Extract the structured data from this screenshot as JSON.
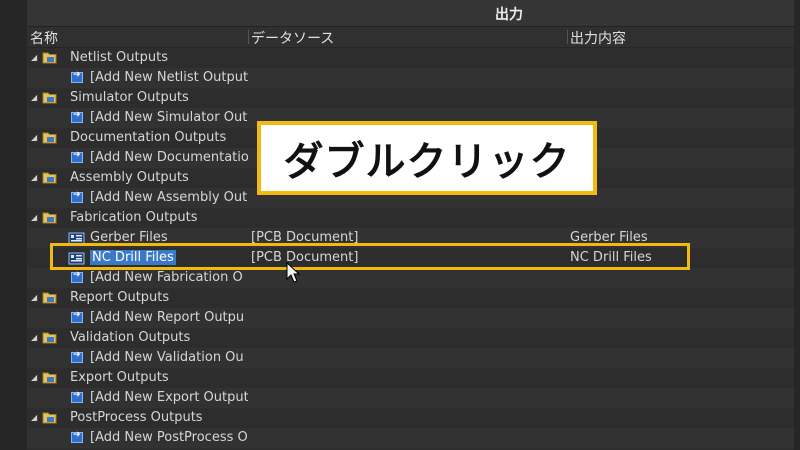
{
  "panel": {
    "title": "出力",
    "columns": [
      "名称",
      "データソース",
      "出力内容"
    ]
  },
  "rows": [
    {
      "kind": "group",
      "name": "Netlist Outputs"
    },
    {
      "kind": "child",
      "name": "[Add New Netlist Output",
      "icon": "add-icon"
    },
    {
      "kind": "group",
      "name": "Simulator Outputs"
    },
    {
      "kind": "child",
      "name": "[Add New Simulator Out",
      "icon": "add-icon"
    },
    {
      "kind": "group",
      "name": "Documentation Outputs"
    },
    {
      "kind": "child",
      "name": "[Add New Documentatio",
      "icon": "add-icon"
    },
    {
      "kind": "group",
      "name": "Assembly Outputs"
    },
    {
      "kind": "child",
      "name": "[Add New Assembly Outp",
      "icon": "add-icon"
    },
    {
      "kind": "group",
      "name": "Fabrication Outputs"
    },
    {
      "kind": "child",
      "name": "Gerber Files",
      "icon": "pcb-file-icon",
      "source": "[PCB Document]",
      "content": "Gerber Files"
    },
    {
      "kind": "child",
      "name": "NC Drill Files",
      "icon": "pcb-file-icon",
      "source": "[PCB Document]",
      "content": "NC Drill Files",
      "selected": true
    },
    {
      "kind": "child",
      "name": "[Add New Fabrication O",
      "icon": "add-icon"
    },
    {
      "kind": "group",
      "name": "Report Outputs"
    },
    {
      "kind": "child",
      "name": "[Add New Report Outpu",
      "icon": "add-icon"
    },
    {
      "kind": "group",
      "name": "Validation Outputs"
    },
    {
      "kind": "child",
      "name": "[Add New Validation Ou",
      "icon": "add-icon"
    },
    {
      "kind": "group",
      "name": "Export Outputs"
    },
    {
      "kind": "child",
      "name": "[Add New Export Output",
      "icon": "add-icon"
    },
    {
      "kind": "group",
      "name": "PostProcess Outputs"
    },
    {
      "kind": "child",
      "name": "[Add New PostProcess O",
      "icon": "add-icon"
    }
  ],
  "callout": {
    "text": "ダブルクリック"
  },
  "colors": {
    "accent": "#f2b90f",
    "selection": "#3a78c8",
    "add_icon": "#2f6fd0"
  }
}
